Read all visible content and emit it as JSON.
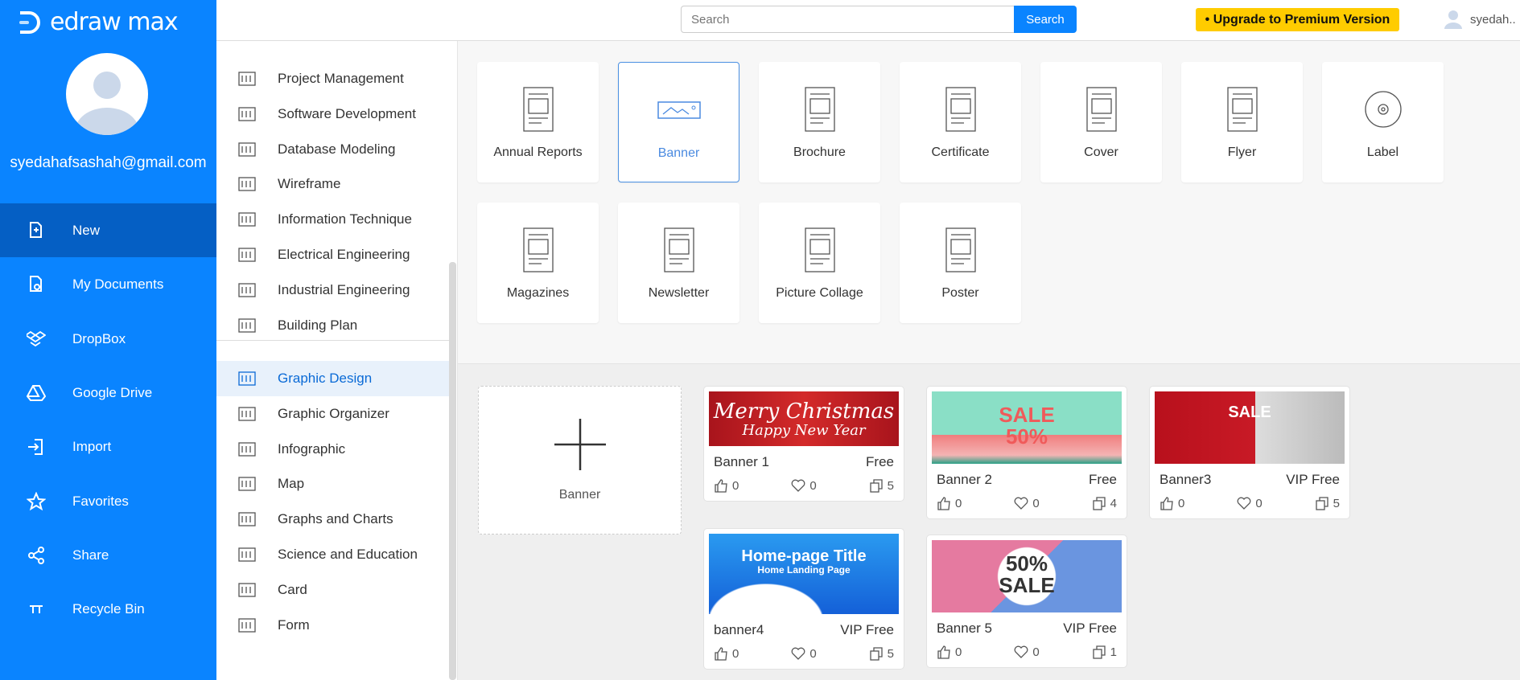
{
  "app": {
    "logo": "edraw max",
    "email": "syedahafsashah@gmail.com"
  },
  "nav": [
    {
      "label": "New",
      "icon": "new-file-icon",
      "active": true
    },
    {
      "label": "My Documents",
      "icon": "documents-icon"
    },
    {
      "label": "DropBox",
      "icon": "dropbox-icon"
    },
    {
      "label": "Google Drive",
      "icon": "google-drive-icon"
    },
    {
      "label": "Import",
      "icon": "import-icon"
    },
    {
      "label": "Favorites",
      "icon": "star-icon"
    },
    {
      "label": "Share",
      "icon": "share-icon"
    },
    {
      "label": "Recycle Bin",
      "icon": "recycle-bin-icon"
    }
  ],
  "topbar": {
    "search_placeholder": "Search",
    "search_label": "Search",
    "upgrade_label": "Upgrade to Premium Version",
    "username": "syedah.."
  },
  "categories": [
    "Project Management",
    "Software Development",
    "Database Modeling",
    "Wireframe",
    "Information Technique",
    "Electrical Engineering",
    "Industrial Engineering",
    "Building Plan"
  ],
  "categories2": [
    {
      "label": "Graphic Design",
      "active": true
    },
    {
      "label": "Graphic Organizer"
    },
    {
      "label": "Infographic"
    },
    {
      "label": "Map"
    },
    {
      "label": "Graphs and Charts"
    },
    {
      "label": "Science and Education"
    },
    {
      "label": "Card"
    },
    {
      "label": "Form"
    }
  ],
  "types": [
    {
      "label": "Annual Reports"
    },
    {
      "label": "Banner",
      "selected": true
    },
    {
      "label": "Brochure"
    },
    {
      "label": "Certificate"
    },
    {
      "label": "Cover"
    },
    {
      "label": "Flyer"
    },
    {
      "label": "Label"
    },
    {
      "label": "Magazines"
    },
    {
      "label": "Newsletter"
    },
    {
      "label": "Picture Collage"
    },
    {
      "label": "Poster"
    }
  ],
  "blank": {
    "label": "Banner"
  },
  "templates": [
    {
      "name": "Banner 1",
      "price": "Free",
      "likes": "0",
      "favs": "0",
      "copies": "5",
      "thumb": [
        "Merry Christmas",
        "Happy New Year"
      ]
    },
    {
      "name": "Banner 2",
      "price": "Free",
      "likes": "0",
      "favs": "0",
      "copies": "4",
      "thumb": [
        "SALE",
        "50%"
      ]
    },
    {
      "name": "Banner3",
      "price": "VIP Free",
      "likes": "0",
      "favs": "0",
      "copies": "5",
      "thumb": [
        "SALE",
        ""
      ]
    },
    {
      "name": "banner4",
      "price": "VIP Free",
      "likes": "0",
      "favs": "0",
      "copies": "5",
      "thumb": [
        "Home-page Title",
        "Home Landing Page"
      ]
    },
    {
      "name": "Banner 5",
      "price": "VIP Free",
      "likes": "0",
      "favs": "0",
      "copies": "1",
      "thumb": [
        "50%",
        "SALE"
      ]
    }
  ],
  "colors": {
    "primary": "#0a84ff",
    "active_nav": "#055fc4",
    "upgrade": "#ffcc00"
  }
}
